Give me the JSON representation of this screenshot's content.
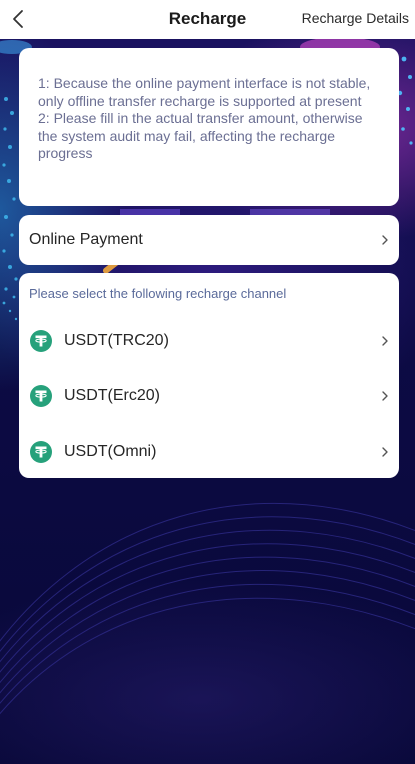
{
  "header": {
    "title": "Recharge",
    "details_label": "Recharge Details"
  },
  "notice": {
    "line1": "1: Because the online payment interface is not stable, only offline transfer recharge is supported at present",
    "line2": "2: Please fill in the actual transfer amount, otherwise the system audit may fail, affecting the recharge progress"
  },
  "online_payment": {
    "label": "Online Payment"
  },
  "channels": {
    "hint": "Please select the following recharge channel",
    "items": [
      {
        "label": "USDT(TRC20)",
        "icon": "tether-icon"
      },
      {
        "label": "USDT(Erc20)",
        "icon": "tether-icon"
      },
      {
        "label": "USDT(Omni)",
        "icon": "tether-icon"
      }
    ]
  },
  "colors": {
    "header_bg": "#ffffff",
    "page_bg": "#0b0a3a",
    "notice_text": "#6b6f93",
    "tether_green": "#26a17b"
  }
}
